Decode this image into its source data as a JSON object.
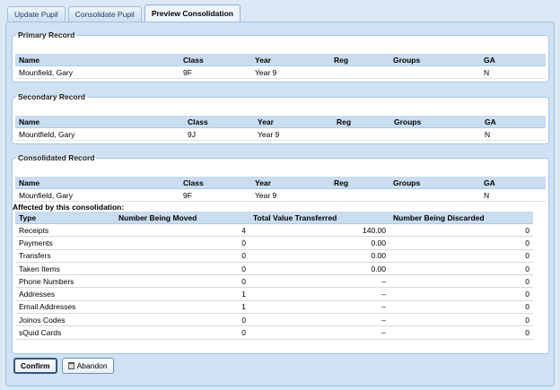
{
  "tabs": [
    "Update Pupil",
    "Consolidate Pupil",
    "Preview Consolidation"
  ],
  "columns": [
    "Name",
    "Class",
    "Year",
    "Reg",
    "Groups",
    "GA"
  ],
  "primary": {
    "title": "Primary Record",
    "row": {
      "name": "Mounfield, Gary",
      "class": "9F",
      "year": "Year 9",
      "reg": "",
      "groups": "",
      "ga": "N"
    }
  },
  "secondary": {
    "title": "Secondary Record",
    "row": {
      "name": "Mountfield, Gary",
      "class": "9J",
      "year": "Year 9",
      "reg": "",
      "groups": "",
      "ga": "N"
    }
  },
  "consolidated": {
    "title": "Consolidated Record",
    "row": {
      "name": "Mounfield, Gary",
      "class": "9F",
      "year": "Year 9",
      "reg": "",
      "groups": "",
      "ga": "N"
    }
  },
  "affected": {
    "title": "Affected by this consolidation:",
    "headers": [
      "Type",
      "Number Being Moved",
      "Total Value Transferred",
      "Number Being Discarded"
    ],
    "rows": [
      {
        "type": "Receipts",
        "moved": "4",
        "value": "140.00",
        "discarded": "0"
      },
      {
        "type": "Payments",
        "moved": "0",
        "value": "0.00",
        "discarded": "0"
      },
      {
        "type": "Transfers",
        "moved": "0",
        "value": "0.00",
        "discarded": "0"
      },
      {
        "type": "Taken Items",
        "moved": "0",
        "value": "0.00",
        "discarded": "0"
      },
      {
        "type": "Phone Numbers",
        "moved": "0",
        "value": "–",
        "discarded": "0"
      },
      {
        "type": "Addresses",
        "moved": "1",
        "value": "–",
        "discarded": "0"
      },
      {
        "type": "Email Addresses",
        "moved": "1",
        "value": "–",
        "discarded": "0"
      },
      {
        "type": "Joinos Codes",
        "moved": "0",
        "value": "–",
        "discarded": "0"
      },
      {
        "type": "sQuid Cards",
        "moved": "0",
        "value": "–",
        "discarded": "0"
      }
    ]
  },
  "buttons": {
    "confirm": "Confirm",
    "abandon": "Abandon",
    "abandon_icon": "trash-icon"
  },
  "colors": {
    "header_bg": "#c9dcf0",
    "panel_bg": "#cfe1f3",
    "page_bg": "#dbe8f5"
  }
}
